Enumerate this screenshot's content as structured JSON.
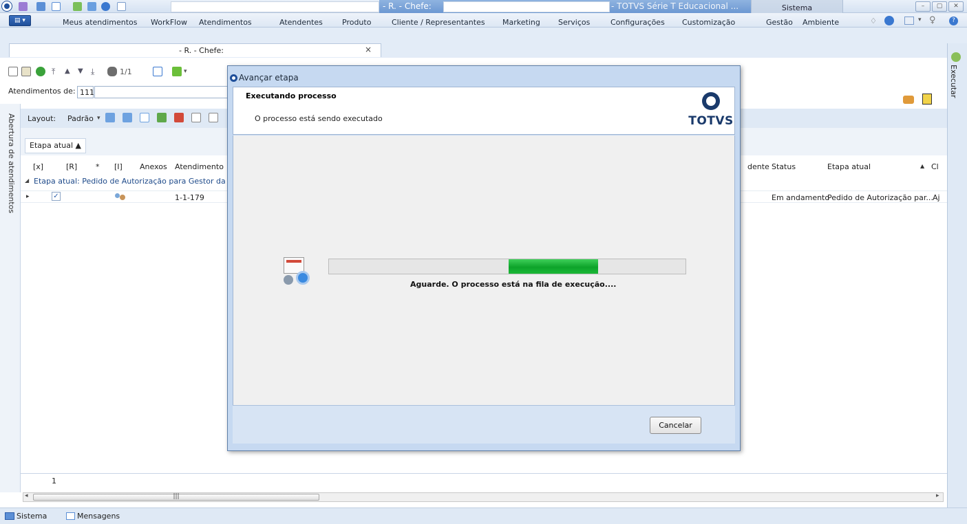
{
  "titlebar": {
    "text_left": "- R. - Chefe:",
    "text_right": "- TOTVS Série T Educacional ...",
    "context_tab": "Sistema"
  },
  "menu": {
    "items": [
      "Meus atendimentos",
      "WorkFlow",
      "Atendimentos",
      "Atendentes",
      "Produto",
      "Cliente / Representantes",
      "Marketing",
      "Serviços",
      "Configurações",
      "Customização",
      "Gestão",
      "Ambiente"
    ]
  },
  "document_tab": {
    "label": "- R. - Chefe:",
    "close": "×"
  },
  "toolbar": {
    "page_indicator": "1/1"
  },
  "filter": {
    "label": "Atendimentos de:",
    "value": "111"
  },
  "side_panel": {
    "left_label": "Abertura de atendimentos",
    "right_label": "Executar"
  },
  "layout_bar": {
    "layout_label": "Layout:",
    "preset": "Padrão"
  },
  "grid": {
    "group_chip": "Etapa atual",
    "columns": [
      "[x]",
      "[R]",
      "*",
      "[I]",
      "Anexos",
      "Atendimento",
      "dente",
      "Status",
      "Etapa atual",
      "Cl"
    ],
    "group_row": "Etapa atual: Pedido de Autorização para Gestor da U",
    "row": {
      "atendimento": "1-1-179",
      "status": "Em andamento",
      "etapa": "Pedido de Autorização par...",
      "cl": "Aj"
    },
    "record_count": "1"
  },
  "status_bar": {
    "items": [
      "Sistema",
      "Mensagens"
    ]
  },
  "dialog": {
    "title": "Avançar etapa",
    "heading": "Executando processo",
    "subheading": "O processo está sendo executado",
    "logo_text": "TOTVS",
    "progress_message": "Aguarde. O processo está na fila de execução....",
    "progress_fraction": 0.25,
    "cancel_label": "Cancelar"
  },
  "colors": {
    "progress_green": "#0da32a",
    "totvs_blue": "#1a3a6b"
  }
}
